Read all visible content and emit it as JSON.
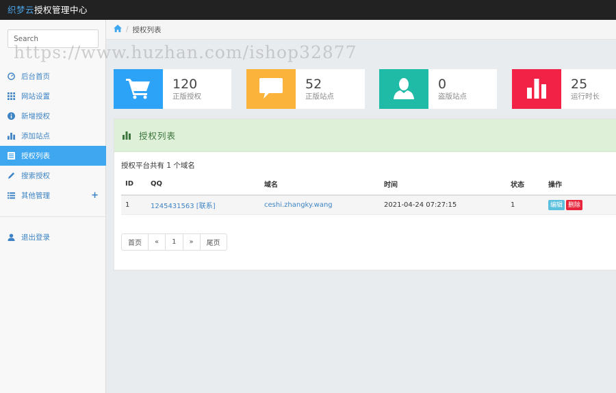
{
  "brand": {
    "accent": "织梦云",
    "rest": "授权管理中心"
  },
  "sidebar": {
    "search_placeholder": "Search",
    "items": [
      {
        "label": "后台首页",
        "icon": "dashboard-icon"
      },
      {
        "label": "网站设置",
        "icon": "grid-icon"
      },
      {
        "label": "新增授权",
        "icon": "info-circle-icon"
      },
      {
        "label": "添加站点",
        "icon": "bar-chart-icon"
      },
      {
        "label": "授权列表",
        "icon": "list-icon",
        "active": true
      },
      {
        "label": "搜索授权",
        "icon": "pencil-icon"
      },
      {
        "label": "其他管理",
        "icon": "list-detail-icon",
        "plus": "+"
      }
    ],
    "logout": "退出登录"
  },
  "breadcrumb": {
    "current": "授权列表",
    "separator": "/"
  },
  "watermark": "https://www.huzhan.com/ishop32877",
  "stats": [
    {
      "value": "120",
      "label": "正版授权",
      "color": "#2da3f7",
      "icon": "cart-icon"
    },
    {
      "value": "52",
      "label": "正版站点",
      "color": "#fbb33c",
      "icon": "comment-icon"
    },
    {
      "value": "0",
      "label": "盗版站点",
      "color": "#1fbba6",
      "icon": "user-icon"
    },
    {
      "value": "25",
      "label": "运行时长",
      "color": "#f22146",
      "icon": "bar-chart-icon"
    }
  ],
  "panel": {
    "title": "授权列表",
    "summary": "授权平台共有 1 个域名",
    "columns": [
      "ID",
      "QQ",
      "域名",
      "时间",
      "状态",
      "操作"
    ],
    "rows": [
      {
        "id": "1",
        "qq": "1245431563 [联系]",
        "domain": "ceshi.zhangky.wang",
        "time": "2021-04-24 07:27:15",
        "status": "1",
        "edit": "编辑",
        "delete": "删除"
      }
    ],
    "pager": [
      "首页",
      "«",
      "1",
      "»",
      "尾页"
    ]
  }
}
